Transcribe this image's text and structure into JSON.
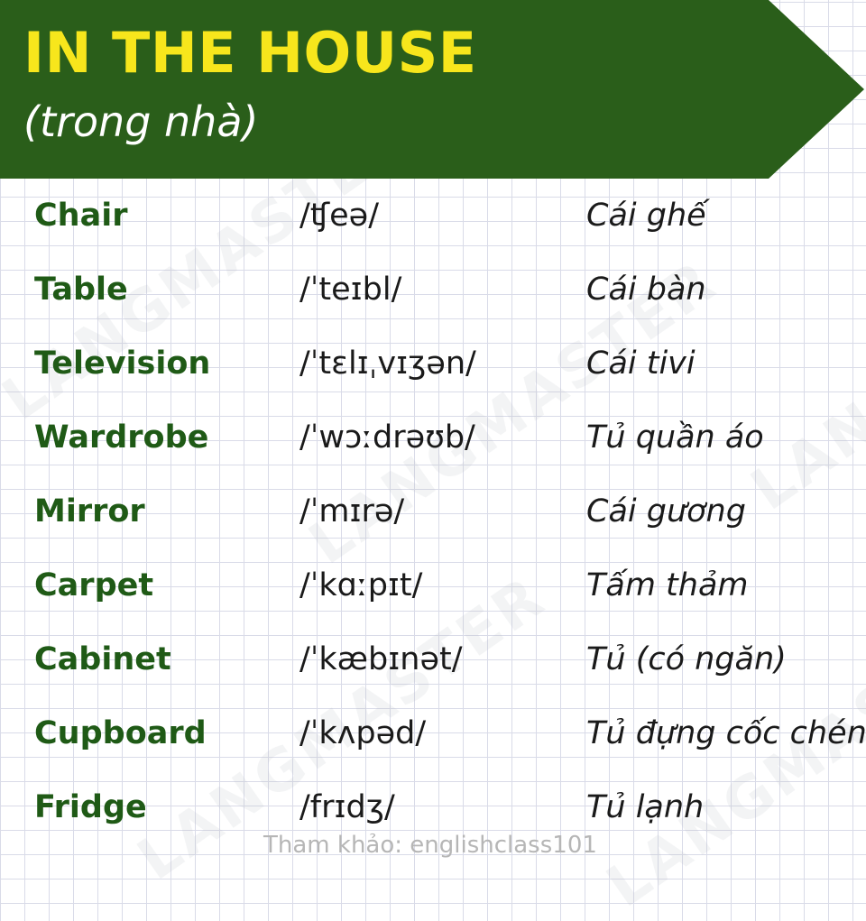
{
  "header": {
    "title": "IN THE HOUSE",
    "subtitle": "(trong nhà)",
    "background_color": "#2a5e1a",
    "title_color": "#f7e61c"
  },
  "vocabulary": [
    {
      "word": "Chair",
      "ipa": "/ʧeə/",
      "meaning": "Cái ghế"
    },
    {
      "word": "Table",
      "ipa": "/ˈteɪbl/",
      "meaning": "Cái bàn"
    },
    {
      "word": "Television",
      "ipa": "/ˈtɛlɪˌvɪʒən/",
      "meaning": "Cái tivi"
    },
    {
      "word": "Wardrobe",
      "ipa": "/ˈwɔːdrəʊb/",
      "meaning": "Tủ quần áo"
    },
    {
      "word": "Mirror",
      "ipa": "/ˈmɪrə/",
      "meaning": "Cái gương"
    },
    {
      "word": "Carpet",
      "ipa": "/ˈkɑːpɪt/",
      "meaning": "Tấm thảm"
    },
    {
      "word": "Cabinet",
      "ipa": "/ˈkæbɪnət/",
      "meaning": "Tủ (có ngăn)"
    },
    {
      "word": "Cupboard",
      "ipa": "/ˈkʌpəd/",
      "meaning": "Tủ đựng cốc chén"
    },
    {
      "word": "Fridge",
      "ipa": "/frɪdʒ/",
      "meaning": "Tủ lạnh"
    }
  ],
  "watermark": "LANGMASTER",
  "footer": "Tham khảo: englishclass101"
}
